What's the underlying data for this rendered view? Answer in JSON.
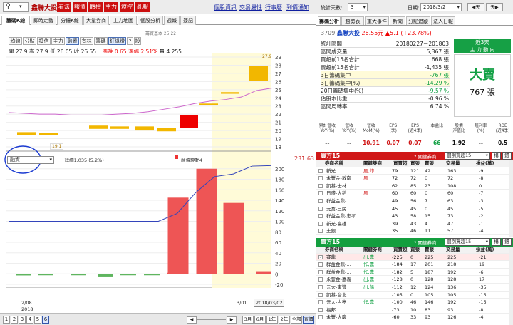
{
  "toolbar": {
    "stock_name": "鑫聯大投",
    "buttons": [
      "看法",
      "報價",
      "體檢",
      "主力",
      "燈控",
      "亂報"
    ],
    "links": [
      "個股資訊",
      "交易屬性",
      "行事曆",
      "到價通知"
    ]
  },
  "tabs": [
    "籌碼K線",
    "即時走勢",
    "分鐘K線",
    "大量券商",
    "主力地圖",
    "個股分析",
    "週報",
    "簽記"
  ],
  "indicator_buttons": [
    "均線",
    "分點",
    "投信",
    "主力",
    "融資",
    "有林",
    "籌碼",
    "紅綠燈",
    "?",
    "設"
  ],
  "legend_main": "籌資基本 25.22",
  "ohlc": {
    "open": "開 27.9",
    "high": "高 27.9",
    "low": "低 26.05",
    "close": "收 26.55",
    "change": "漲跌 0.65",
    "pct": "漲幅 2.51%",
    "vol": "量 4,255"
  },
  "price_axis": [
    "29",
    "28",
    "27",
    "26",
    "25",
    "24",
    "23",
    "22",
    "21",
    "20",
    "19",
    "18"
  ],
  "candle_labels": {
    "top": "27.9",
    "low": "19.1"
  },
  "sub_select": "融資",
  "sub_legend": {
    "series1": "一 詳細1,035 (5.2%)",
    "series2": "融資變動4",
    "value": "231.63"
  },
  "sub_axis": [
    "200",
    "180",
    "160",
    "140",
    "120",
    "100",
    "80",
    "60",
    "40",
    "20",
    "0",
    "-20"
  ],
  "x_labels": {
    "a": "2/08",
    "b": "2018",
    "c": "3/01",
    "d": "2018/03/02"
  },
  "bottom": {
    "pages": [
      "1",
      "2",
      "3",
      "4",
      "5",
      "6"
    ],
    "ranges": [
      "3月",
      "6月",
      "1年",
      "2年",
      "全部",
      "查價"
    ]
  },
  "right": {
    "days_label": "統計天數:",
    "days_value": "3",
    "date_label": "日期:",
    "date_value": "2018/3/2",
    "prev": "◀天",
    "next": "天▶",
    "tabs": [
      "籌碼分析",
      "趨勢表",
      "重大事件",
      "新聞",
      "分點追蹤",
      "法人日報"
    ],
    "code": "3709",
    "name": "鑫聯大投",
    "price": "26.55元",
    "chg": "▲5.1 (+23.78%)",
    "stats": [
      {
        "k": "統計區間",
        "v": "20180227－201803"
      },
      {
        "k": "區間成交量",
        "v": "5,367 張"
      },
      {
        "k": "買超前15名合計",
        "v": "668 張"
      },
      {
        "k": "賣超前15名合計",
        "v": "-1,435 張"
      },
      {
        "k": "3日籌碼集中",
        "v": "-767 張"
      },
      {
        "k": "3日籌碼集中(%)",
        "v": "-14.29 %"
      },
      {
        "k": "20日籌碼集中(%)",
        "v": "-9.57 %"
      },
      {
        "k": "佔股本比重",
        "v": "-0.96 %"
      },
      {
        "k": "區間周轉率",
        "v": "6.74 %"
      }
    ],
    "trend_days": "近3天",
    "trend_sub": "主 力 動 向",
    "trend_big": "大賣",
    "trend_val": "767 張",
    "fin_heads": [
      "累計營收\nYoY(%)",
      "營收\nYoY(%)",
      "營收\nMoM(%)",
      "EPS\n(季)",
      "EPS\n(近4季)",
      "本益比",
      "股價\n淨值比",
      "殖利率\n(%)",
      "ROE\n(近4季)"
    ],
    "fin_vals": [
      "--",
      "--",
      "10.91",
      "0.07",
      "0.07",
      "66",
      "1.92",
      "--",
      "0.5"
    ],
    "buy_title": "買方15",
    "sell_title": "賣方15",
    "filter_label": "? 關鍵券商:",
    "filter_value": "個別買超15",
    "filter_btn1": "構",
    "filter_btn2": "鈕",
    "cols": [
      "券商名稱",
      "關鍵券商",
      "買賣超",
      "買張",
      "賣張",
      "交易量",
      "損益(萬)"
    ],
    "buy_rows": [
      [
        "新光",
        "風,炸",
        "79",
        "121",
        "42",
        "163",
        "-9"
      ],
      [
        "永豐金-敦南",
        "風",
        "72",
        "72",
        "0",
        "72",
        "-8"
      ],
      [
        "凱基-士林",
        "",
        "62",
        "85",
        "23",
        "108",
        "0"
      ],
      [
        "日盛-大稻",
        "風",
        "60",
        "60",
        "0",
        "60",
        "-7"
      ],
      [
        "群益金鼎-...",
        "",
        "49",
        "56",
        "7",
        "63",
        "-3"
      ],
      [
        "元富-三民",
        "",
        "45",
        "45",
        "0",
        "45",
        "-5"
      ],
      [
        "群益金鼎-忠孝",
        "",
        "43",
        "58",
        "15",
        "73",
        "-2"
      ],
      [
        "新光-高雄",
        "",
        "39",
        "43",
        "4",
        "47",
        "-1"
      ],
      [
        "土銀",
        "",
        "35",
        "46",
        "11",
        "57",
        "-4"
      ]
    ],
    "sell_rows": [
      [
        "賽鼎",
        "出,農",
        "-225",
        "0",
        "225",
        "225",
        "-21"
      ],
      [
        "群益金鼎-...",
        "作,農",
        "-184",
        "17",
        "201",
        "218",
        "19"
      ],
      [
        "群益金鼎-...",
        "作,農",
        "-182",
        "5",
        "187",
        "192",
        "-6"
      ],
      [
        "永豐金-嘉義",
        "出,農",
        "-128",
        "0",
        "128",
        "128",
        "17"
      ],
      [
        "元大-東豐",
        "出,船",
        "-112",
        "12",
        "124",
        "136",
        "-35"
      ],
      [
        "凱基-台北",
        "",
        "-105",
        "0",
        "105",
        "105",
        "-15"
      ],
      [
        "元大-古亭",
        "作,農",
        "-100",
        "46",
        "146",
        "192",
        "-15"
      ],
      [
        "福邦",
        "",
        "-73",
        "10",
        "83",
        "93",
        "-8"
      ],
      [
        "永豐-大慶",
        "",
        "-60",
        "33",
        "93",
        "126",
        "-4"
      ]
    ]
  },
  "chart_data": [
    {
      "type": "candlestick",
      "title": "",
      "ylim": [
        18,
        29
      ],
      "candles": [
        {
          "x": "a",
          "open": 19.4,
          "close": 19.8,
          "color": "#f2b700"
        },
        {
          "x": "b",
          "open": 19.4,
          "close": 19.7,
          "color": "#f2b700"
        },
        {
          "x": "c",
          "open": 20.2,
          "close": 20.6,
          "color": "#f2b700"
        },
        {
          "x": "d",
          "open": 20.2,
          "close": 20.5,
          "color": "#f2b700"
        },
        {
          "x": "e",
          "open": 20.0,
          "close": 20.5,
          "color": "#f2b700"
        },
        {
          "x": "f",
          "open": 19.9,
          "close": 20.3,
          "color": "#f2b700"
        },
        {
          "x": "g",
          "open": 21.9,
          "close": 20.3,
          "color": "#ee0000"
        },
        {
          "x": "h",
          "open": 23.2,
          "close": 23.3,
          "color": "#f2b700"
        },
        {
          "x": "i",
          "open": 24.5,
          "close": 24.7,
          "color": "#f2b700"
        },
        {
          "x": "j",
          "open": 26.05,
          "close": 27.9,
          "color": "#f2b700"
        }
      ],
      "line": [
        22.2,
        22.1,
        22.0,
        22.0,
        21.9,
        21.9,
        21.9,
        22.0,
        22.1,
        22.3,
        22.6,
        22.9,
        23.3,
        23.6,
        23.8,
        24.1,
        24.9,
        25.2
      ]
    },
    {
      "type": "bar",
      "title": "",
      "ylim": [
        -20,
        220
      ],
      "values": [
        -3,
        -2,
        -2,
        -5,
        -2,
        -1,
        2,
        0,
        0,
        145,
        200,
        135,
        5
      ],
      "bar_colors": [
        "#5fb55f",
        "#5fb55f",
        "#5fb55f",
        "#5fb55f",
        "#5fb55f",
        "#5fb55f",
        "#ee5555",
        "#ee5555",
        "#ee5555",
        "#ee5555",
        "#ee5555",
        "#ee5555",
        "#ee5555"
      ],
      "line": [
        100,
        100,
        100,
        100,
        100,
        100,
        100,
        100,
        100,
        115,
        155,
        185,
        190,
        205,
        206
      ]
    }
  ]
}
